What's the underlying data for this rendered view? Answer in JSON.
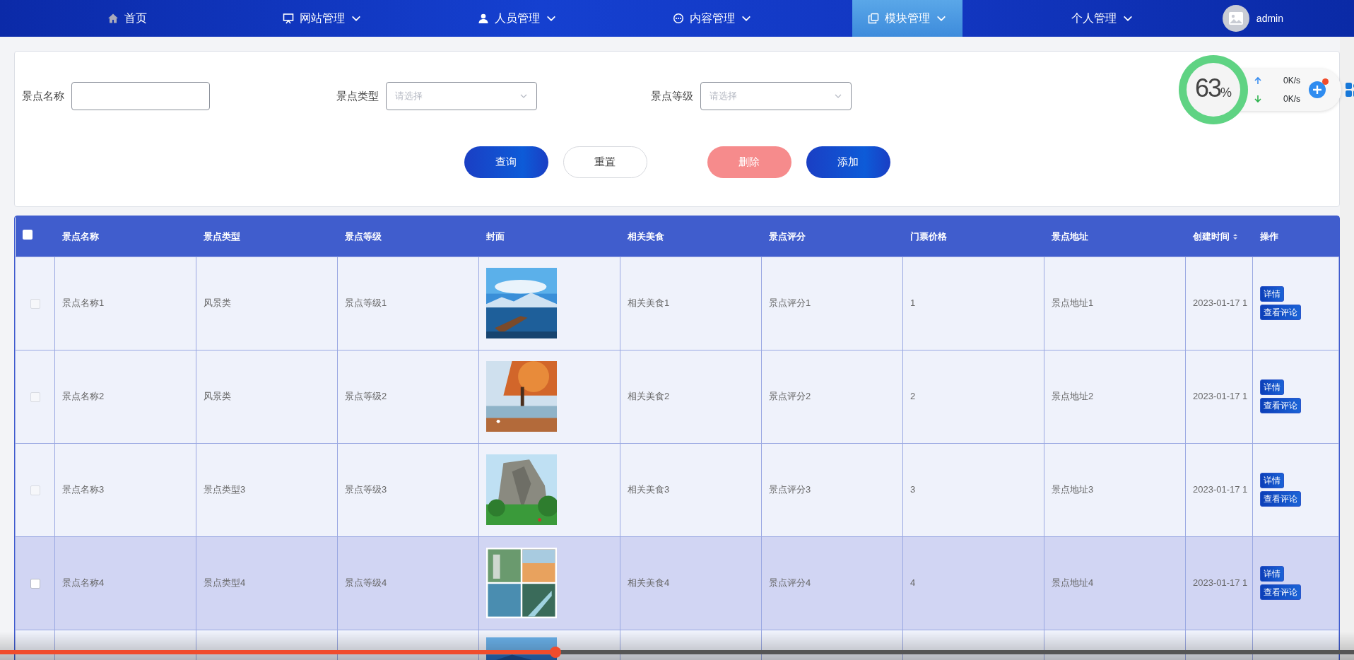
{
  "nav": {
    "items": [
      {
        "label": "首页",
        "caret": false,
        "selected": false
      },
      {
        "label": "网站管理",
        "caret": true,
        "selected": false
      },
      {
        "label": "人员管理",
        "caret": true,
        "selected": false
      },
      {
        "label": "内容管理",
        "caret": true,
        "selected": false
      },
      {
        "label": "模块管理",
        "caret": true,
        "selected": true
      },
      {
        "label": "个人管理",
        "caret": true,
        "selected": false
      }
    ],
    "user": {
      "name": "admin"
    }
  },
  "filters": [
    {
      "label": "景点名称",
      "kind": "text"
    },
    {
      "label": "景点类型",
      "kind": "select",
      "placeholder": "请选择"
    },
    {
      "label": "景点等级",
      "kind": "select",
      "placeholder": "请选择"
    }
  ],
  "buttons": [
    {
      "label": "查询",
      "kind": "primary"
    },
    {
      "label": "重置",
      "kind": "outline"
    },
    {
      "label": "删除",
      "kind": "danger"
    },
    {
      "label": "添加",
      "kind": "primary"
    }
  ],
  "widget": {
    "percent": "63",
    "unit": "%",
    "upload": "0K/s",
    "download": "0K/s",
    "badge": true
  },
  "table": {
    "select_all": false,
    "columns": [
      {
        "label": "景点名称",
        "sortable": false
      },
      {
        "label": "景点类型",
        "sortable": false
      },
      {
        "label": "景点等级",
        "sortable": false
      },
      {
        "label": "封面",
        "sortable": false
      },
      {
        "label": "相关美食",
        "sortable": false
      },
      {
        "label": "景点评分",
        "sortable": false
      },
      {
        "label": "门票价格",
        "sortable": false
      },
      {
        "label": "景点地址",
        "sortable": false
      },
      {
        "label": "创建时间",
        "sortable": true
      },
      {
        "label": "操作",
        "sortable": false
      }
    ],
    "rows": [
      {
        "checked": false,
        "hovered": false,
        "cells": [
          "景点名称1",
          "风景类",
          "景点等级1",
          {
            "kind": "picture"
          },
          "相关美食1",
          "景点评分1",
          "1",
          "景点地址1",
          "2023-01-17 1"
        ],
        "actions": [
          "详情",
          "查看评论"
        ]
      },
      {
        "checked": false,
        "hovered": false,
        "cells": [
          "景点名称2",
          "风景类",
          "景点等级2",
          {
            "kind": "picture"
          },
          "相关美食2",
          "景点评分2",
          "2",
          "景点地址2",
          "2023-01-17 1"
        ],
        "actions": [
          "详情",
          "查看评论"
        ]
      },
      {
        "checked": false,
        "hovered": false,
        "cells": [
          "景点名称3",
          "景点类型3",
          "景点等级3",
          {
            "kind": "picture"
          },
          "相关美食3",
          "景点评分3",
          "3",
          "景点地址3",
          "2023-01-17 1"
        ],
        "actions": [
          "详情",
          "查看评论"
        ]
      },
      {
        "checked": false,
        "hovered": true,
        "cells": [
          "景点名称4",
          "景点类型4",
          "景点等级4",
          {
            "kind": "picture"
          },
          "相关美食4",
          "景点评分4",
          "4",
          "景点地址4",
          "2023-01-17 1"
        ],
        "actions": [
          "详情",
          "查看评论"
        ]
      },
      {
        "cells": [
          {
            "kind": "picture"
          }
        ]
      }
    ]
  },
  "video_bar": {
    "level": 0.41
  }
}
